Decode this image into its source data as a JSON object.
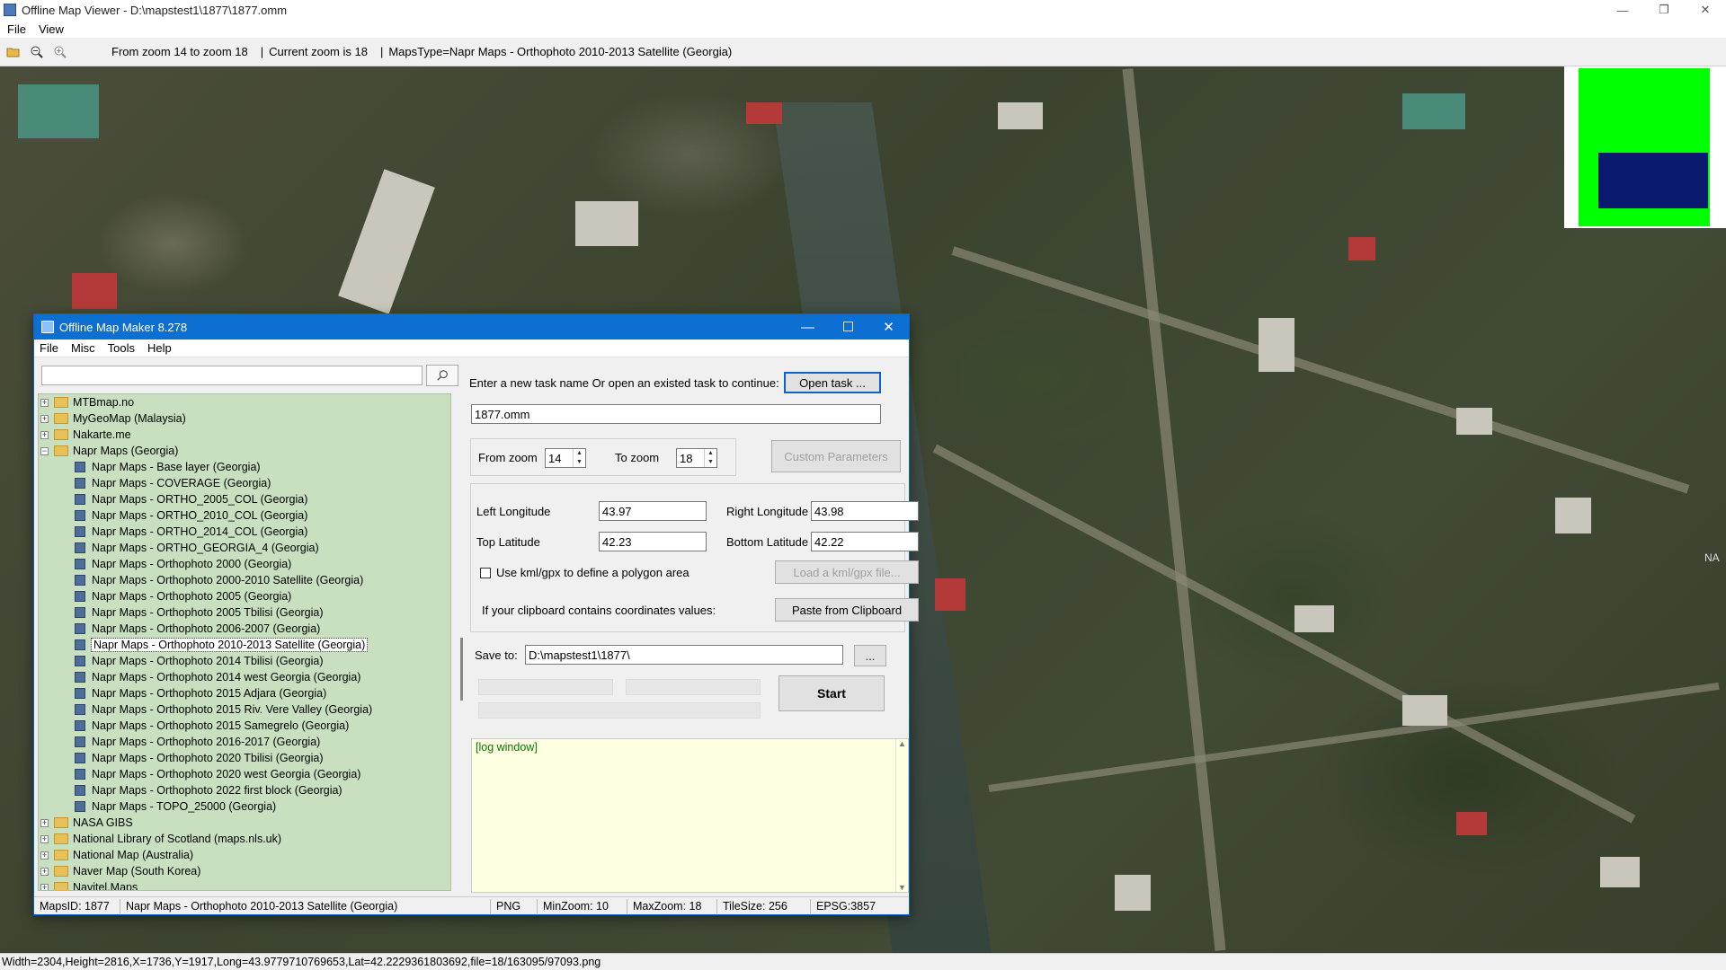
{
  "window": {
    "title": "Offline Map Viewer - D:\\mapstest1\\1877\\1877.omm",
    "menu": [
      "File",
      "View"
    ],
    "controls": {
      "minimize": "—",
      "restore": "❐",
      "close": "✕"
    }
  },
  "toolbar": {
    "zoom_range": "From zoom 14 to zoom 18",
    "separator1": "|",
    "current_zoom": "Current zoom is 18",
    "separator2": "|",
    "maps_type": "MapsType=Napr Maps - Orthophoto 2010-2013 Satellite (Georgia)",
    "icons": [
      "open-folder-icon",
      "zoom-out-icon",
      "zoom-in-icon"
    ]
  },
  "map": {
    "edge_label": "NA"
  },
  "dialog": {
    "title": "Offline Map Maker 8.278",
    "menu": [
      "File",
      "Misc",
      "Tools",
      "Help"
    ],
    "controls": {
      "minimize": "—",
      "maximize": "☐",
      "close": "✕"
    },
    "search": {
      "placeholder": "",
      "value": ""
    },
    "tree": [
      {
        "label": "MTBmap.no",
        "type": "folder",
        "expander": "+"
      },
      {
        "label": "MyGeoMap (Malaysia)",
        "type": "folder",
        "expander": "+"
      },
      {
        "label": "Nakarte.me",
        "type": "folder",
        "expander": "+"
      },
      {
        "label": "Napr Maps (Georgia)",
        "type": "folder-open",
        "expander": "−"
      },
      {
        "label": "Napr Maps - Base layer (Georgia)",
        "type": "map"
      },
      {
        "label": "Napr Maps - COVERAGE (Georgia)",
        "type": "map"
      },
      {
        "label": "Napr Maps - ORTHO_2005_COL (Georgia)",
        "type": "map"
      },
      {
        "label": "Napr Maps - ORTHO_2010_COL (Georgia)",
        "type": "map"
      },
      {
        "label": "Napr Maps - ORTHO_2014_COL (Georgia)",
        "type": "map"
      },
      {
        "label": "Napr Maps - ORTHO_GEORGIA_4 (Georgia)",
        "type": "map"
      },
      {
        "label": "Napr Maps - Orthophoto 2000 (Georgia)",
        "type": "map"
      },
      {
        "label": "Napr Maps - Orthophoto 2000-2010 Satellite (Georgia)",
        "type": "map"
      },
      {
        "label": "Napr Maps - Orthophoto 2005 (Georgia)",
        "type": "map"
      },
      {
        "label": "Napr Maps - Orthophoto 2005 Tbilisi (Georgia)",
        "type": "map"
      },
      {
        "label": "Napr Maps - Orthophoto 2006-2007 (Georgia)",
        "type": "map"
      },
      {
        "label": "Napr Maps - Orthophoto 2010-2013 Satellite (Georgia)",
        "type": "map",
        "selected": true
      },
      {
        "label": "Napr Maps - Orthophoto 2014 Tbilisi (Georgia)",
        "type": "map"
      },
      {
        "label": "Napr Maps - Orthophoto 2014 west Georgia (Georgia)",
        "type": "map"
      },
      {
        "label": "Napr Maps - Orthophoto 2015 Adjara (Georgia)",
        "type": "map"
      },
      {
        "label": "Napr Maps - Orthophoto 2015 Riv. Vere Valley (Georgia)",
        "type": "map"
      },
      {
        "label": "Napr Maps - Orthophoto 2015 Samegrelo (Georgia)",
        "type": "map"
      },
      {
        "label": "Napr Maps - Orthophoto 2016-2017 (Georgia)",
        "type": "map"
      },
      {
        "label": "Napr Maps - Orthophoto 2020 Tbilisi (Georgia)",
        "type": "map"
      },
      {
        "label": "Napr Maps - Orthophoto 2020 west Georgia (Georgia)",
        "type": "map"
      },
      {
        "label": "Napr Maps - Orthophoto 2022 first block (Georgia)",
        "type": "map"
      },
      {
        "label": "Napr Maps - TOPO_25000 (Georgia)",
        "type": "map"
      },
      {
        "label": "NASA GIBS",
        "type": "folder",
        "expander": "+"
      },
      {
        "label": "National Library of Scotland (maps.nls.uk)",
        "type": "folder",
        "expander": "+"
      },
      {
        "label": "National Map (Australia)",
        "type": "folder",
        "expander": "+"
      },
      {
        "label": "Naver Map (South Korea)",
        "type": "folder",
        "expander": "+"
      },
      {
        "label": "Navitel.Maps",
        "type": "folder",
        "expander": "+"
      }
    ],
    "task": {
      "prompt": "Enter a new task name Or open an existed task to continue:",
      "open_button": "Open task ...",
      "name_value": "1877.omm"
    },
    "zoom": {
      "from_label": "From zoom",
      "from_value": "14",
      "to_label": "To zoom",
      "to_value": "18",
      "custom_button": "Custom Parameters"
    },
    "coords": {
      "left_lon_label": "Left Longitude",
      "left_lon_value": "43.97",
      "right_lon_label": "Right Longitude",
      "right_lon_value": "43.98",
      "top_lat_label": "Top Latitude",
      "top_lat_value": "42.23",
      "bottom_lat_label": "Bottom Latitude",
      "bottom_lat_value": "42.22",
      "kml_label": "Use kml/gpx to define a polygon area",
      "kml_button": "Load a kml/gpx file...",
      "clipboard_label": "If your clipboard contains coordinates values:",
      "clipboard_button": "Paste from Clipboard"
    },
    "save": {
      "label": "Save to:",
      "value": "D:\\mapstest1\\1877\\",
      "browse_button": "...",
      "start_button": "Start"
    },
    "log": {
      "text": "[log window]"
    },
    "status": {
      "maps_id": "MapsID: 1877",
      "maps_name": "Napr Maps - Orthophoto 2010-2013 Satellite (Georgia)",
      "format": "PNG",
      "min_zoom": "MinZoom: 10",
      "max_zoom": "MaxZoom: 18",
      "tile_size": "TileSize: 256",
      "epsg": "EPSG:3857"
    }
  },
  "statusbar": {
    "text": "Width=2304,Height=2816,X=1736,Y=1917,Long=43.9779710769653,Lat=42.2229361803692,file=18/163095/97093.png"
  },
  "colors": {
    "dialog_title": "#0d6fd1",
    "tree_background": "#c8dfc0",
    "log_background": "#ffffe1",
    "log_text": "#007a00",
    "overview_green": "#00ff00",
    "overview_blue": "#0a1a6e"
  }
}
